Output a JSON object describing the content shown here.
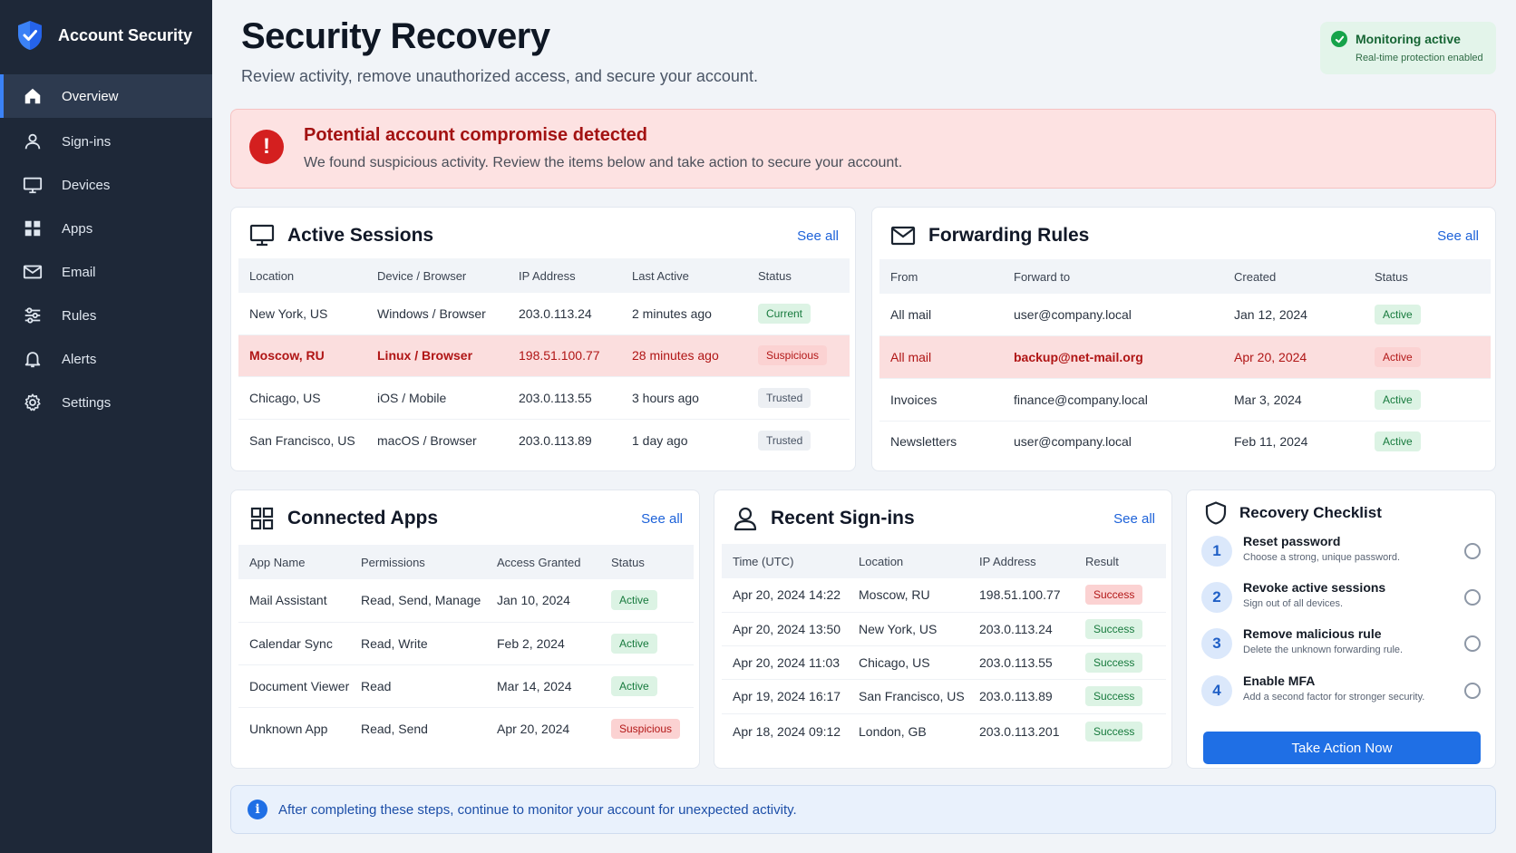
{
  "app": {
    "title": "Account Security"
  },
  "sidebar": {
    "items": [
      {
        "label": "Overview",
        "icon": "home-icon",
        "active": true
      },
      {
        "label": "Sign-ins",
        "icon": "user-icon"
      },
      {
        "label": "Devices",
        "icon": "monitor-icon"
      },
      {
        "label": "Apps",
        "icon": "grid-icon"
      },
      {
        "label": "Email",
        "icon": "mail-icon"
      },
      {
        "label": "Rules",
        "icon": "sliders-icon"
      },
      {
        "label": "Alerts",
        "icon": "bell-icon"
      },
      {
        "label": "Settings",
        "icon": "gear-icon"
      }
    ]
  },
  "header": {
    "title": "Security Recovery",
    "subtitle": "Review activity, remove unauthorized access, and secure your account."
  },
  "monitoring": {
    "title": "Monitoring active",
    "subtitle": "Real-time protection enabled"
  },
  "alert": {
    "title": "Potential account compromise detected",
    "message": "We found suspicious activity. Review the items below and take action to secure your account."
  },
  "sessions": {
    "title": "Active Sessions",
    "see_all": "See all",
    "columns": [
      "Location",
      "Device / Browser",
      "IP Address",
      "Last Active",
      "Status"
    ],
    "rows": [
      {
        "location": "New York, US",
        "device": "Windows / Browser",
        "ip": "203.0.113.24",
        "last": "2 minutes ago",
        "status": "Current"
      },
      {
        "location": "Moscow, RU",
        "device": "Linux / Browser",
        "ip": "198.51.100.77",
        "last": "28 minutes ago",
        "status": "Suspicious"
      },
      {
        "location": "Chicago, US",
        "device": "iOS / Mobile",
        "ip": "203.0.113.55",
        "last": "3 hours ago",
        "status": "Trusted"
      },
      {
        "location": "San Francisco, US",
        "device": "macOS / Browser",
        "ip": "203.0.113.89",
        "last": "1 day ago",
        "status": "Trusted"
      }
    ]
  },
  "forwarding": {
    "title": "Forwarding Rules",
    "see_all": "See all",
    "columns": [
      "From",
      "Forward to",
      "Created",
      "Status"
    ],
    "rows": [
      {
        "from": "All mail",
        "to": "user@company.local",
        "created": "Jan 12, 2024",
        "status": "Active"
      },
      {
        "from": "All mail",
        "to": "backup@net-mail.org",
        "created": "Apr 20, 2024",
        "status": "Active"
      },
      {
        "from": "Invoices",
        "to": "finance@company.local",
        "created": "Mar 3, 2024",
        "status": "Active"
      },
      {
        "from": "Newsletters",
        "to": "user@company.local",
        "created": "Feb 11, 2024",
        "status": "Active"
      }
    ]
  },
  "apps": {
    "title": "Connected Apps",
    "see_all": "See all",
    "columns": [
      "App Name",
      "Permissions",
      "Access Granted",
      "Status"
    ],
    "rows": [
      {
        "name": "Mail Assistant",
        "perm": "Read, Send, Manage",
        "granted": "Jan 10, 2024",
        "status": "Active"
      },
      {
        "name": "Calendar Sync",
        "perm": "Read, Write",
        "granted": "Feb 2, 2024",
        "status": "Active"
      },
      {
        "name": "Document Viewer",
        "perm": "Read",
        "granted": "Mar 14, 2024",
        "status": "Active"
      },
      {
        "name": "Unknown App",
        "perm": "Read, Send",
        "granted": "Apr 20, 2024",
        "status": "Suspicious"
      }
    ]
  },
  "signins": {
    "title": "Recent Sign-ins",
    "see_all": "See all",
    "columns": [
      "Time (UTC)",
      "Location",
      "IP Address",
      "Result"
    ],
    "rows": [
      {
        "time": "Apr 20, 2024 14:22",
        "location": "Moscow, RU",
        "ip": "198.51.100.77",
        "result": "Success"
      },
      {
        "time": "Apr 20, 2024 13:50",
        "location": "New York, US",
        "ip": "203.0.113.24",
        "result": "Success"
      },
      {
        "time": "Apr 20, 2024 11:03",
        "location": "Chicago, US",
        "ip": "203.0.113.55",
        "result": "Success"
      },
      {
        "time": "Apr 19, 2024 16:17",
        "location": "San Francisco, US",
        "ip": "203.0.113.89",
        "result": "Success"
      },
      {
        "time": "Apr 18, 2024 09:12",
        "location": "London, GB",
        "ip": "203.0.113.201",
        "result": "Success"
      }
    ]
  },
  "checklist": {
    "title": "Recovery Checklist",
    "steps": [
      {
        "num": "1",
        "title": "Reset password",
        "desc": "Choose a strong, unique password."
      },
      {
        "num": "2",
        "title": "Revoke active sessions",
        "desc": "Sign out of all devices."
      },
      {
        "num": "3",
        "title": "Remove malicious rule",
        "desc": "Delete the unknown forwarding rule."
      },
      {
        "num": "4",
        "title": "Enable MFA",
        "desc": "Add a second factor for stronger security."
      }
    ],
    "button": "Take Action Now"
  },
  "footer": {
    "info": "After completing these steps, continue to monitor your account for unexpected activity."
  },
  "colors": {
    "sidebar": "#1e2838",
    "accent": "#1f6fe5",
    "danger": "#d41f1f",
    "success": "#16a34a"
  }
}
